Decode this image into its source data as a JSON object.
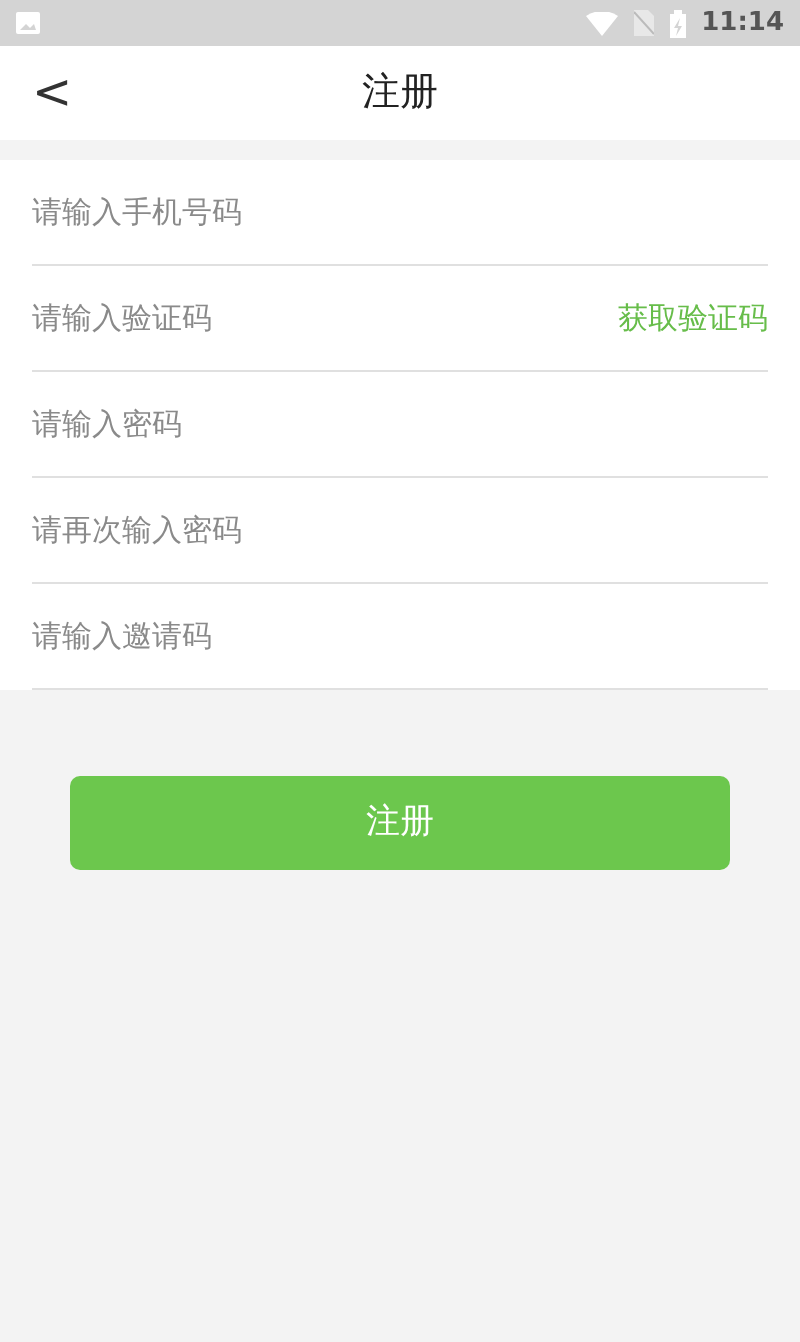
{
  "status_bar": {
    "time": "11:14"
  },
  "header": {
    "back": "<",
    "title": "注册"
  },
  "fields": [
    {
      "placeholder": "请输入手机号码"
    },
    {
      "placeholder": "请输入验证码",
      "action": "获取验证码"
    },
    {
      "placeholder": "请输入密码"
    },
    {
      "placeholder": "请再次输入密码"
    },
    {
      "placeholder": "请输入邀请码"
    }
  ],
  "submit": {
    "label": "注册"
  }
}
